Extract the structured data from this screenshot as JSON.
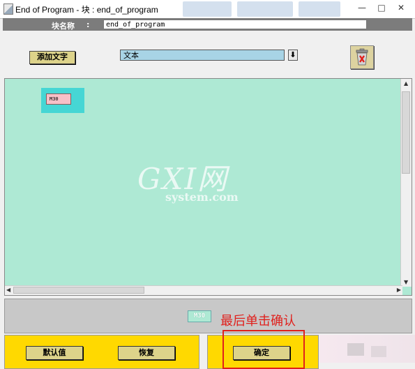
{
  "window": {
    "title": "End of Program  - 块 : end_of_program",
    "minimize": "—",
    "maximize": "□",
    "close": "✕"
  },
  "header": {
    "block_name_label": "块名称",
    "colon": ":",
    "block_name_value": "end_of_program"
  },
  "toolbar": {
    "add_text_label": "添加文字",
    "type_value": "文本",
    "dropdown_arrow": "⬇"
  },
  "canvas": {
    "node_text": "M30",
    "watermark_main": "GXI网",
    "watermark_sub": "system.com"
  },
  "preview": {
    "chip_text": "M30"
  },
  "annotation": {
    "text": "最后单击确认"
  },
  "buttons": {
    "default_label": "默认值",
    "restore_label": "恢复",
    "confirm_label": "确定"
  },
  "colors": {
    "canvas_bg": "#aee9d4",
    "panel_yellow": "#ffd900",
    "annotation_red": "#e0201c"
  }
}
